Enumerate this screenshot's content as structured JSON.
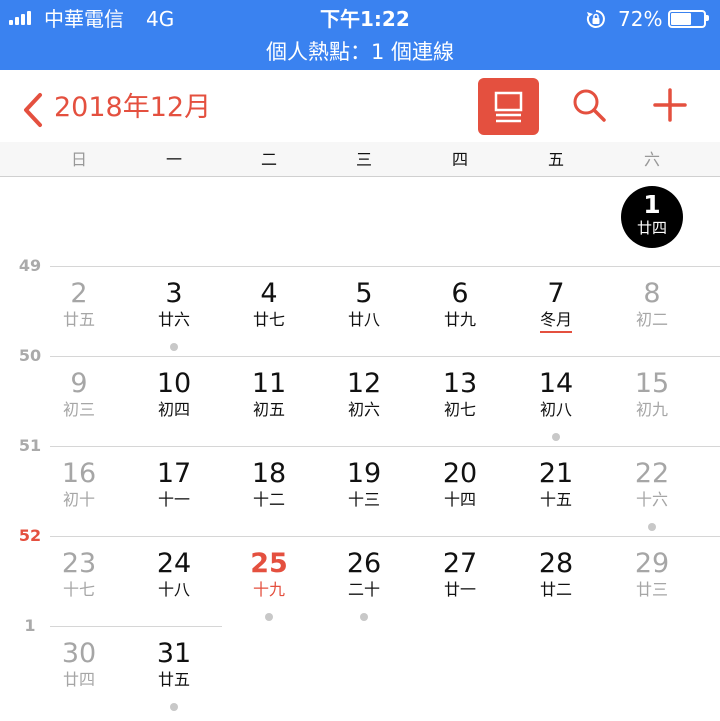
{
  "status_bar": {
    "carrier": "中華電信",
    "network": "4G",
    "time": "下午1:22",
    "battery": "72%",
    "battery_level": 0.72,
    "hotspot": "個人熱點：1 個連線"
  },
  "nav": {
    "title": "2018年12月",
    "back_icon": "chevron-left-icon",
    "list_icon": "list-view-icon",
    "search_icon": "search-icon",
    "add_icon": "plus-icon",
    "accent": "#e4503f"
  },
  "weekdays": [
    "日",
    "一",
    "二",
    "三",
    "四",
    "五",
    "六"
  ],
  "weeks": [
    {
      "label": "",
      "days": [
        {
          "col": 6,
          "num": "1",
          "lunar": "廿四",
          "selected": true
        }
      ]
    },
    {
      "label": "49",
      "days": [
        {
          "col": 0,
          "num": "2",
          "lunar": "廿五",
          "weekend": true
        },
        {
          "col": 1,
          "num": "3",
          "lunar": "廿六",
          "dot": true
        },
        {
          "col": 2,
          "num": "4",
          "lunar": "廿七"
        },
        {
          "col": 3,
          "num": "5",
          "lunar": "廿八"
        },
        {
          "col": 4,
          "num": "6",
          "lunar": "廿九"
        },
        {
          "col": 5,
          "num": "7",
          "lunar": "冬月",
          "solar_term": true
        },
        {
          "col": 6,
          "num": "8",
          "lunar": "初二",
          "weekend": true
        }
      ]
    },
    {
      "label": "50",
      "days": [
        {
          "col": 0,
          "num": "9",
          "lunar": "初三",
          "weekend": true
        },
        {
          "col": 1,
          "num": "10",
          "lunar": "初四"
        },
        {
          "col": 2,
          "num": "11",
          "lunar": "初五"
        },
        {
          "col": 3,
          "num": "12",
          "lunar": "初六"
        },
        {
          "col": 4,
          "num": "13",
          "lunar": "初七"
        },
        {
          "col": 5,
          "num": "14",
          "lunar": "初八",
          "dot": true
        },
        {
          "col": 6,
          "num": "15",
          "lunar": "初九",
          "weekend": true
        }
      ]
    },
    {
      "label": "51",
      "days": [
        {
          "col": 0,
          "num": "16",
          "lunar": "初十",
          "weekend": true
        },
        {
          "col": 1,
          "num": "17",
          "lunar": "十一"
        },
        {
          "col": 2,
          "num": "18",
          "lunar": "十二"
        },
        {
          "col": 3,
          "num": "19",
          "lunar": "十三"
        },
        {
          "col": 4,
          "num": "20",
          "lunar": "十四"
        },
        {
          "col": 5,
          "num": "21",
          "lunar": "十五"
        },
        {
          "col": 6,
          "num": "22",
          "lunar": "十六",
          "weekend": true,
          "dot": true
        }
      ]
    },
    {
      "label": "52",
      "current": true,
      "days": [
        {
          "col": 0,
          "num": "23",
          "lunar": "十七",
          "weekend": true
        },
        {
          "col": 1,
          "num": "24",
          "lunar": "十八"
        },
        {
          "col": 2,
          "num": "25",
          "lunar": "十九",
          "today": true,
          "dot": true
        },
        {
          "col": 3,
          "num": "26",
          "lunar": "二十",
          "dot": true
        },
        {
          "col": 4,
          "num": "27",
          "lunar": "廿一"
        },
        {
          "col": 5,
          "num": "28",
          "lunar": "廿二"
        },
        {
          "col": 6,
          "num": "29",
          "lunar": "廿三",
          "weekend": true
        }
      ]
    },
    {
      "label": "1",
      "days": [
        {
          "col": 0,
          "num": "30",
          "lunar": "廿四",
          "weekend": true
        },
        {
          "col": 1,
          "num": "31",
          "lunar": "廿五",
          "dot": true
        }
      ]
    }
  ]
}
